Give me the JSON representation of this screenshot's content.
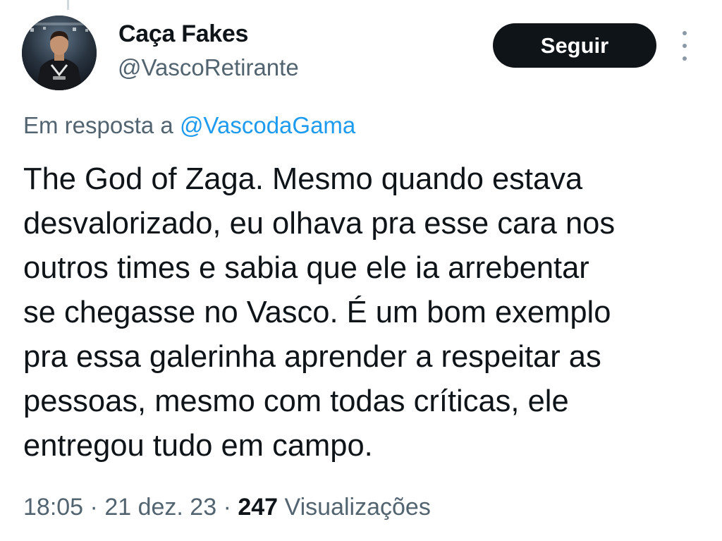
{
  "user": {
    "name": "Caça Fakes",
    "handle": "@VascoRetirante"
  },
  "actions": {
    "follow_label": "Seguir",
    "more_icon": "more-vertical-icon"
  },
  "reply": {
    "prefix": "Em resposta a",
    "mention": "@VascodaGama"
  },
  "tweet": {
    "lines": [
      "The God of Zaga. Mesmo quando estava",
      "desvalorizado, eu olhava pra esse cara nos",
      "outros times e sabia que ele ia arrebentar",
      "se chegasse no Vasco. É um bom exemplo",
      "pra essa galerinha aprender a respeitar as",
      "pessoas, mesmo com todas críticas, ele",
      "entregou tudo em campo."
    ]
  },
  "meta": {
    "time": "18:05",
    "date": "21 dez. 23",
    "separator": "·",
    "views_count": "247",
    "views_label": "Visualizações"
  },
  "colors": {
    "text_primary": "#0f1419",
    "text_secondary": "#536471",
    "link": "#1d9bf0",
    "button_bg": "#0f1419",
    "button_text": "#ffffff"
  }
}
